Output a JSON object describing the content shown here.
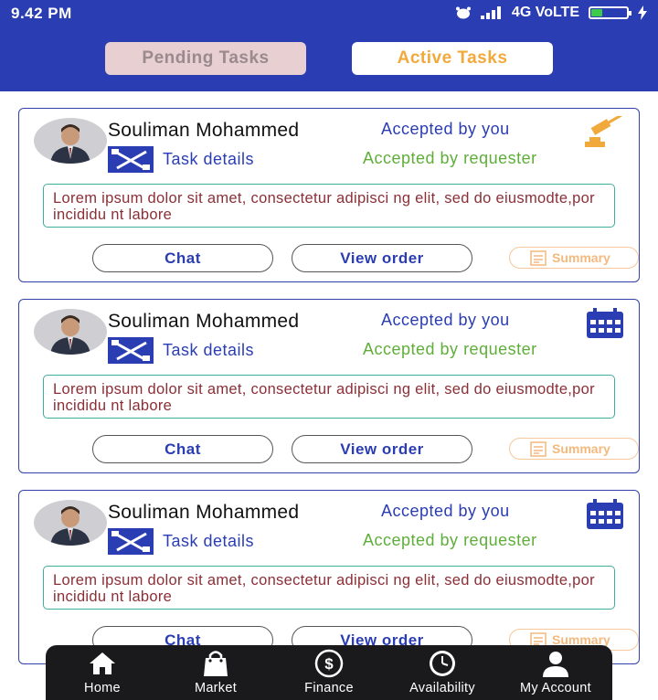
{
  "status_bar": {
    "time": "9.42 PM",
    "network": "4G VoLTE",
    "battery_level": 0.3
  },
  "tabs": [
    {
      "label": "Pending Tasks"
    },
    {
      "label": "Active Tasks"
    }
  ],
  "cards": [
    {
      "name": "Souliman Mohammed",
      "accepted_by_you": "Accepted by you",
      "accepted_by_requester": "Accepted by requester",
      "task_details": "Task details",
      "description": "Lorem ipsum dolor sit amet, consectetur adipisci ng elit, sed do eiusmodte,por incididu nt labore",
      "chat_label": "Chat",
      "order_label": "View order",
      "summary_label": "Summary",
      "corner_icon": "gavel-icon"
    },
    {
      "name": "Souliman Mohammed",
      "accepted_by_you": "Accepted by you",
      "accepted_by_requester": "Accepted by requester",
      "task_details": "Task details",
      "description": "Lorem ipsum dolor sit amet, consectetur adipisci ng elit, sed do eiusmodte,por incididu nt labore",
      "chat_label": "Chat",
      "order_label": "View order",
      "summary_label": "Summary",
      "corner_icon": "calendar-icon"
    },
    {
      "name": "Souliman Mohammed",
      "accepted_by_you": "Accepted by you",
      "accepted_by_requester": "Accepted by requester",
      "task_details": "Task details",
      "description": "Lorem ipsum dolor sit amet, consectetur adipisci ng elit, sed do eiusmodte,por incididu nt labore",
      "chat_label": "Chat",
      "order_label": "View order",
      "summary_label": "Summary",
      "corner_icon": "calendar-icon"
    }
  ],
  "nav": [
    {
      "label": "Home",
      "icon": "home-icon"
    },
    {
      "label": "Market",
      "icon": "shopping-bag-icon"
    },
    {
      "label": "Finance",
      "icon": "dollar-icon"
    },
    {
      "label": "Availability",
      "icon": "clock-icon"
    },
    {
      "label": "My Account",
      "icon": "user-icon"
    }
  ],
  "colors": {
    "primary": "#2a3db2",
    "accent_orange": "#f2a93b",
    "accent_green": "#5fae3a",
    "description_text": "#8b2f37"
  }
}
